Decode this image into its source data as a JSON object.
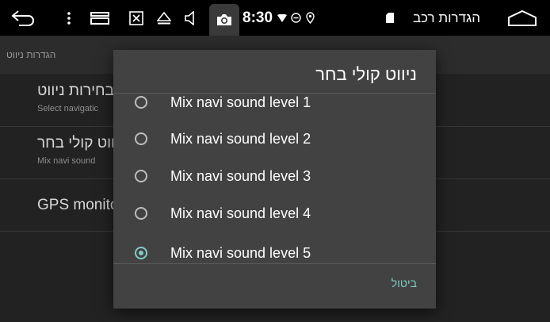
{
  "statusbar": {
    "icons": [
      "back-icon",
      "more-icon",
      "recents-icon",
      "screenshot-icon",
      "eject-icon",
      "volume-icon",
      "camera-icon",
      "wifi-icon",
      "do-not-disturb-icon",
      "location-icon",
      "sd-card-icon",
      "home-icon"
    ],
    "time": "8:30",
    "app_title": "הגדרות רכב"
  },
  "page": {
    "header_title": "הגדרות ניווט",
    "settings": [
      {
        "title": "בחירות ניווט",
        "subtitle": "Select navigatic"
      },
      {
        "title": "ניווט קולי בחר",
        "subtitle": "Mix navi sound"
      },
      {
        "title": "GPS monito",
        "subtitle": ""
      }
    ]
  },
  "dialog": {
    "title": "ניווט קולי בחר",
    "options": [
      {
        "label": "Mix navi sound level 1",
        "checked": false
      },
      {
        "label": "Mix navi sound level 2",
        "checked": false
      },
      {
        "label": "Mix navi sound level 3",
        "checked": false
      },
      {
        "label": "Mix navi sound level 4",
        "checked": false
      },
      {
        "label": "Mix navi sound level 5",
        "checked": true
      }
    ],
    "cancel_label": "ביטול"
  },
  "colors": {
    "accent": "#80cbc4",
    "dialog_bg": "#424242",
    "statusbar_bg": "#000000"
  }
}
